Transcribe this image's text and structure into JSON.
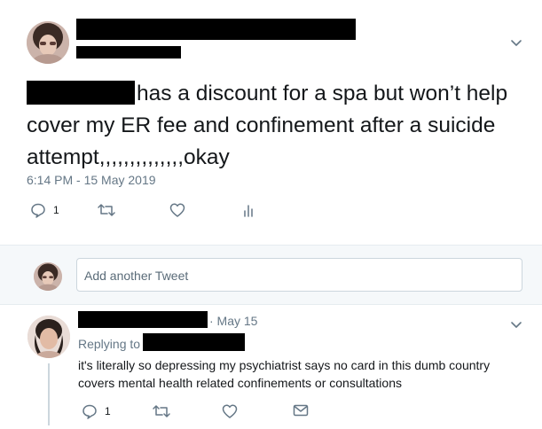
{
  "tweet": {
    "text_after_redaction": "has a discount for a spa but won’t help cover my ER fee and confinement after a suicide attempt,,,,,,,,,,,,,,okay",
    "timestamp": "6:14 PM - 15 May 2019",
    "reply_count": "1",
    "icons": {
      "reply": "reply-icon",
      "retweet": "retweet-icon",
      "like": "heart-icon",
      "analytics": "analytics-icon",
      "menu": "chevron-down-icon"
    }
  },
  "compose": {
    "placeholder": "Add another Tweet"
  },
  "reply": {
    "time": "· May 15",
    "replying_to_label": "Replying to",
    "text": "it's literally so depressing my psychiatrist says no card in this dumb country covers mental health related confinements or consultations",
    "reply_count": "1",
    "icons": {
      "reply": "reply-icon",
      "retweet": "retweet-icon",
      "like": "heart-icon",
      "dm": "envelope-icon",
      "menu": "chevron-down-icon"
    }
  },
  "colors": {
    "text": "#14171a",
    "secondary": "#657786",
    "compose_bg": "#f5f8fa",
    "border": "#e6ecf0",
    "redaction": "#000000"
  }
}
